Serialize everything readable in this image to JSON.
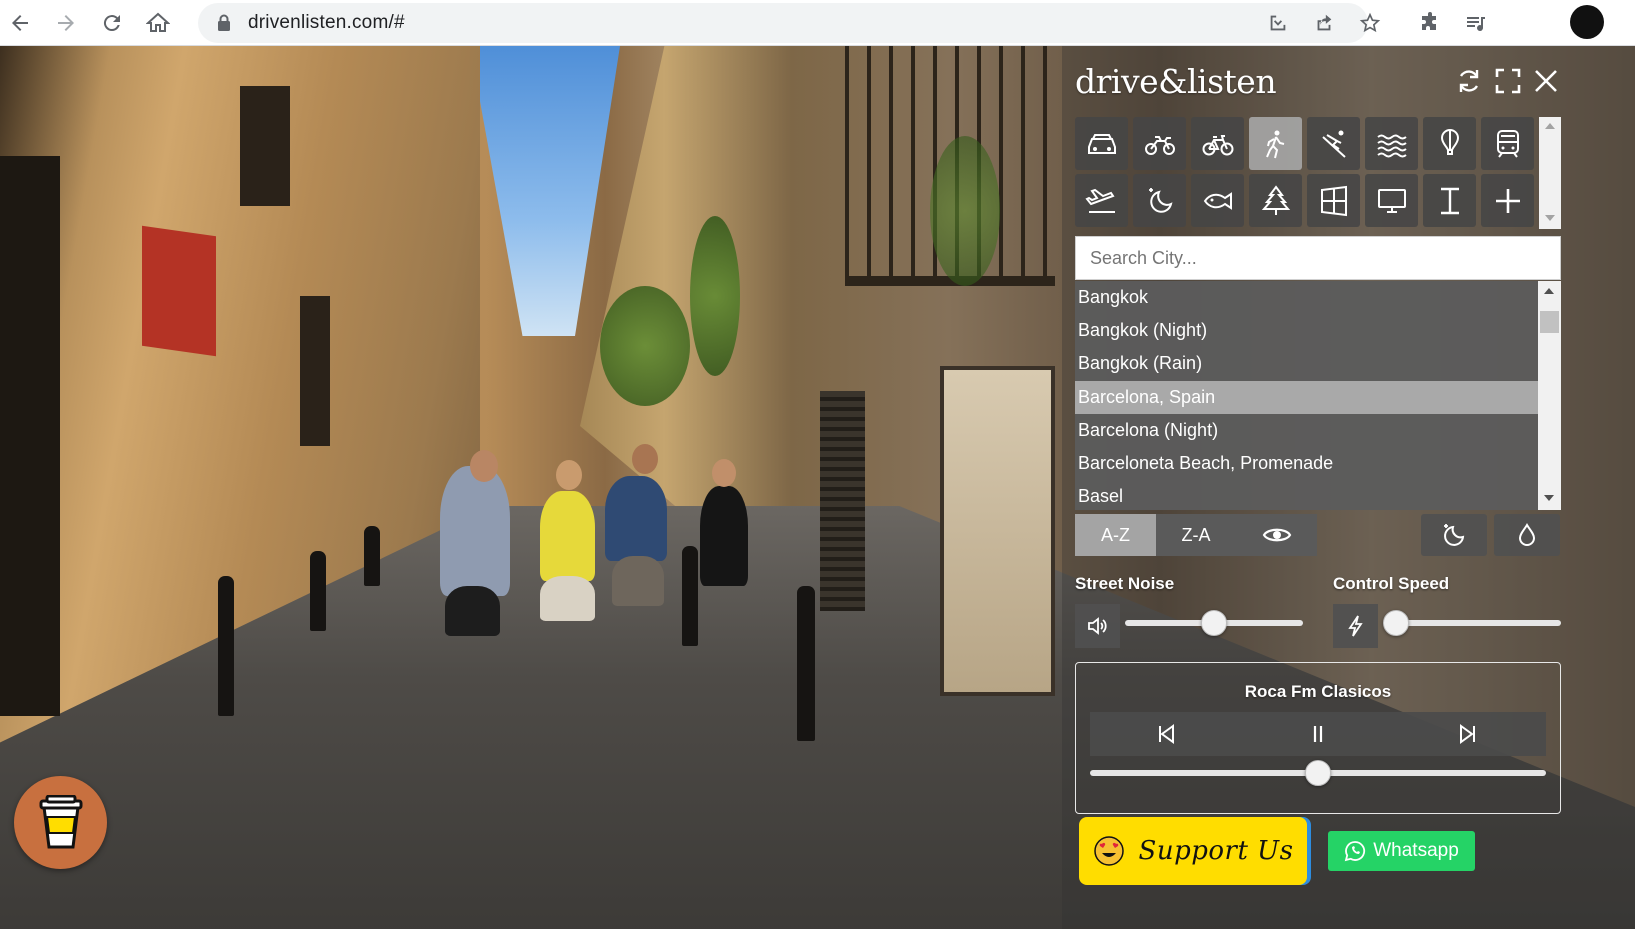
{
  "browser": {
    "url": "drivenlisten.com/#"
  },
  "app": {
    "logo": "drive&listen",
    "search_placeholder": "Search City...",
    "cities": [
      "Bangkok",
      "Bangkok (Night)",
      "Bangkok (Rain)",
      "Barcelona, Spain",
      "Barcelona (Night)",
      "Barceloneta Beach, Promenade",
      "Basel"
    ],
    "selected_city": "Barcelona, Spain",
    "active_mode": "walk",
    "sort": {
      "az_label": "A-Z",
      "za_label": "Z-A",
      "active": "A-Z"
    },
    "street_noise": {
      "label": "Street Noise",
      "level": 0.5
    },
    "control_speed": {
      "label": "Control Speed",
      "level": 0.0
    },
    "radio": {
      "station": "Roca Fm Clasicos",
      "volume": 0.5
    },
    "support_label": "Support Us",
    "whatsapp_label": "Whatsapp"
  },
  "colors": {
    "support_yellow": "#ffdd00",
    "whatsapp_green": "#25d366",
    "coffee_orange": "#c8703f",
    "active_grey": "#a4a4a4"
  },
  "icons": {
    "mode_row_1": [
      "car-icon",
      "motorbike-icon",
      "bicycle-icon",
      "walk-icon",
      "ski-icon",
      "water-icon",
      "balloon-icon",
      "train-icon"
    ],
    "mode_row_2": [
      "plane-icon",
      "night-mode-icon",
      "fish-icon",
      "tree-icon",
      "window-icon",
      "monitor-icon",
      "cursor-text-icon",
      "plus-icon"
    ]
  }
}
